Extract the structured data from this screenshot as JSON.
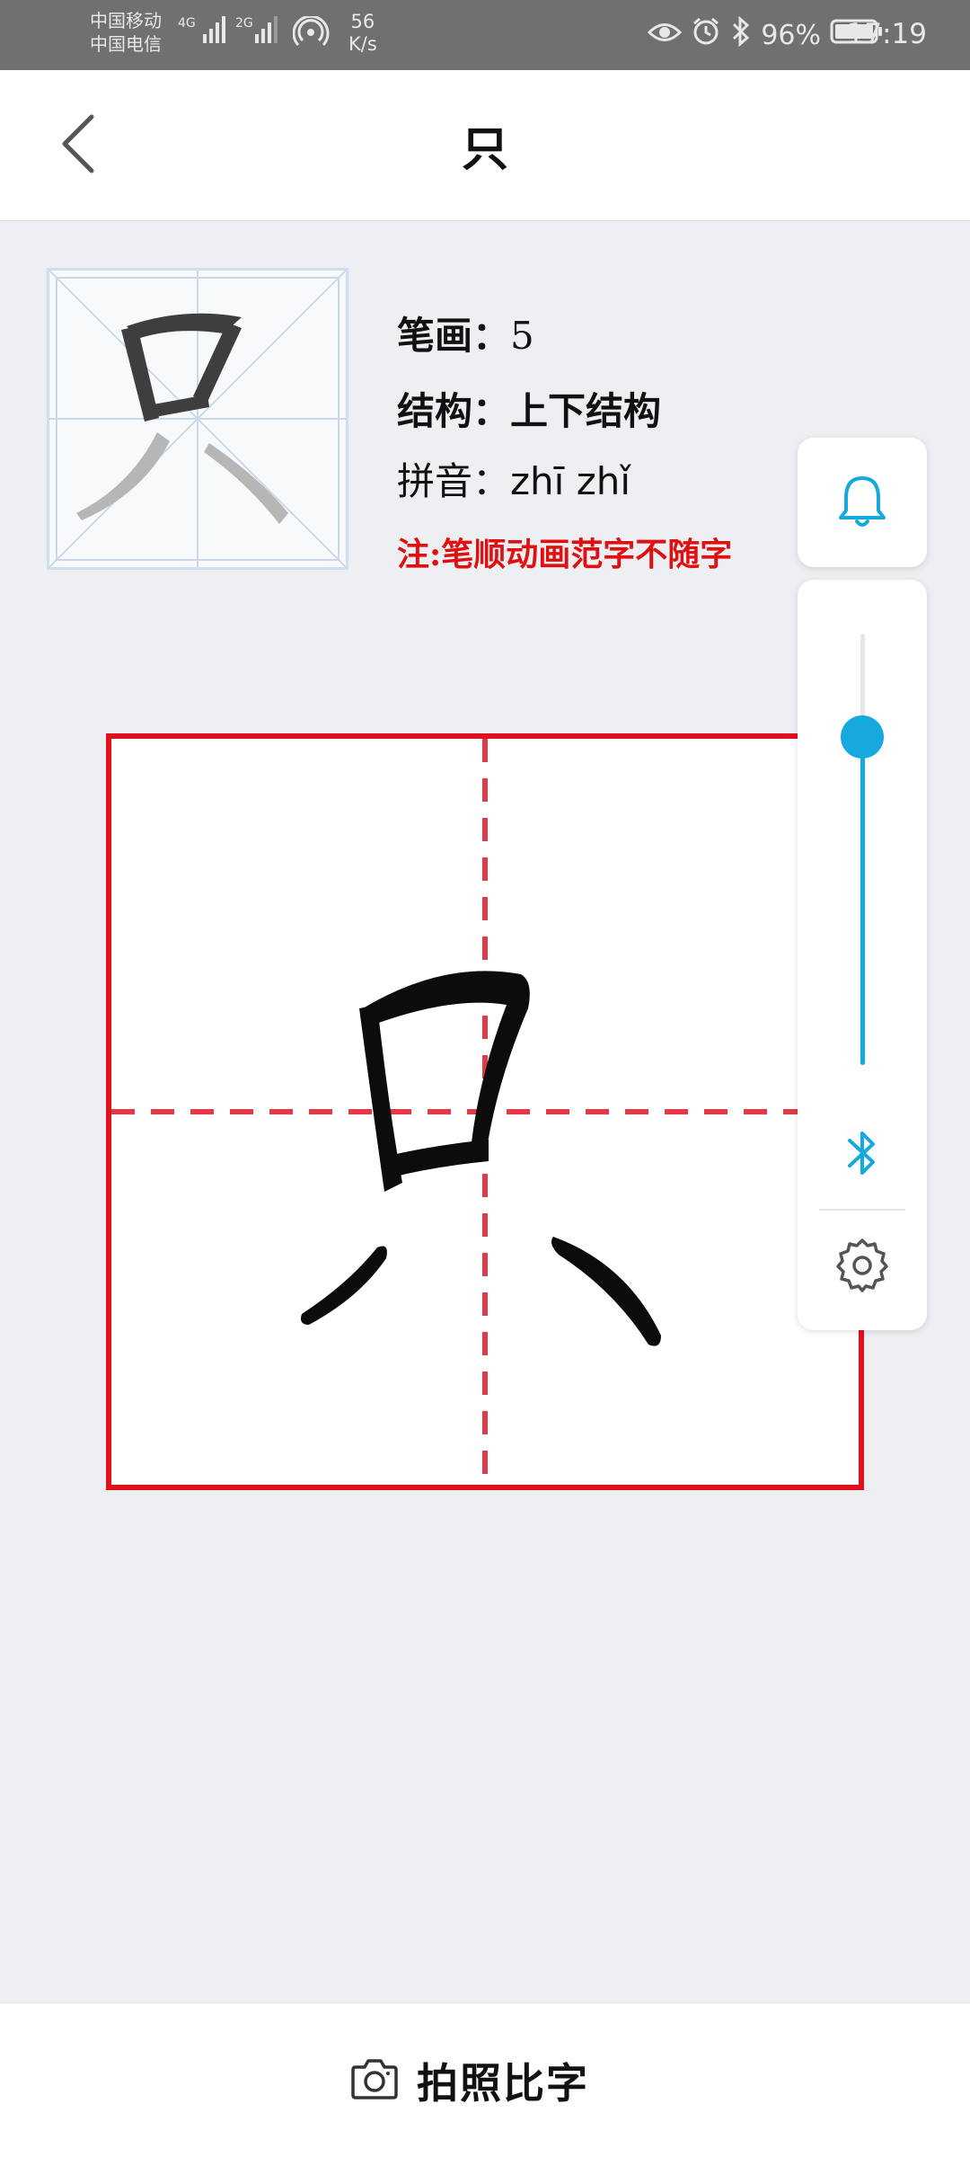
{
  "status_bar": {
    "carrier_1": "中国移动",
    "carrier_2": "中国电信",
    "signal_1": "4G",
    "signal_2": "2G",
    "net_speed_value": "56",
    "net_speed_unit": "K/s",
    "battery": "96%",
    "time": "17:19",
    "icons": [
      "eye-icon",
      "alarm-icon",
      "bluetooth-icon",
      "battery-icon"
    ]
  },
  "header": {
    "title": "只",
    "back_icon": "chevron-left-icon"
  },
  "character": {
    "glyph": "只",
    "strokes_label": "笔画：",
    "strokes_value": "5",
    "structure_label": "结构：",
    "structure_value": "上下结构",
    "pinyin_label": "拼音：",
    "pinyin_value": "zhī zhǐ",
    "note": "注:笔顺动画范字不随字"
  },
  "side_panel": {
    "bell_icon": "bell-icon",
    "slider_level": 0.76,
    "bluetooth_icon": "bluetooth-icon",
    "settings_icon": "gear-icon"
  },
  "colors": {
    "accent": "#16a9de",
    "grid_border": "#e0101c",
    "grid_dash": "#e23a48",
    "note": "#e01010"
  },
  "bottom_bar": {
    "photo_compare_label": "拍照比字",
    "camera_icon": "camera-icon"
  }
}
